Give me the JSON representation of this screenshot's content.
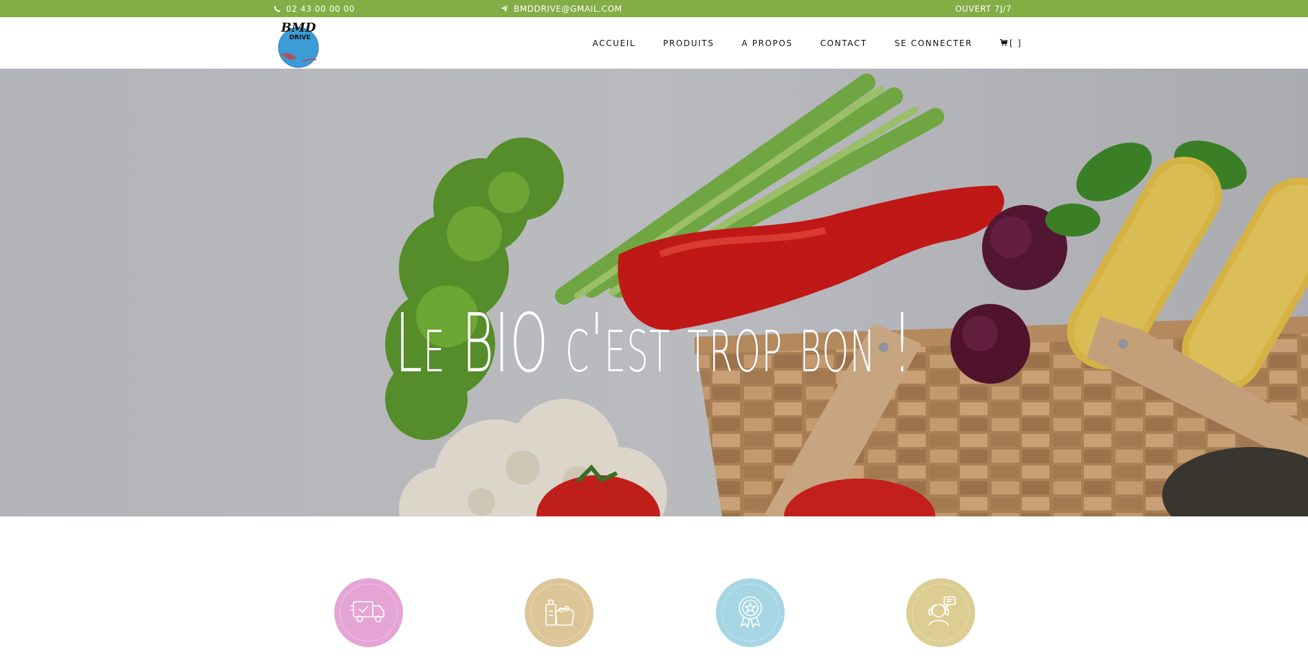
{
  "topbar": {
    "phone": "02 43 00 00 00",
    "email": "BMDDRIVE@GMAIL.COM",
    "hours": "OUVERT 7J/7",
    "background": "#82ae46"
  },
  "logo": {
    "line1": "BMD",
    "line2": "DRIVE"
  },
  "nav": {
    "items": [
      {
        "label": "ACCUEIL"
      },
      {
        "label": "PRODUITS"
      },
      {
        "label": "A PROPOS"
      },
      {
        "label": "CONTACT"
      },
      {
        "label": "SE CONNECTER"
      }
    ],
    "cart_icon": "cart-icon",
    "cart_label": "[ ]"
  },
  "hero": {
    "title": "Le BIO c'est trop bon !"
  },
  "features": [
    {
      "icon": "delivery-truck-icon",
      "color": "#e4a5d4"
    },
    {
      "icon": "groceries-bag-icon",
      "color": "#dcc698"
    },
    {
      "icon": "quality-badge-icon",
      "color": "#a6d6e4"
    },
    {
      "icon": "customer-support-icon",
      "color": "#dccd93"
    }
  ]
}
